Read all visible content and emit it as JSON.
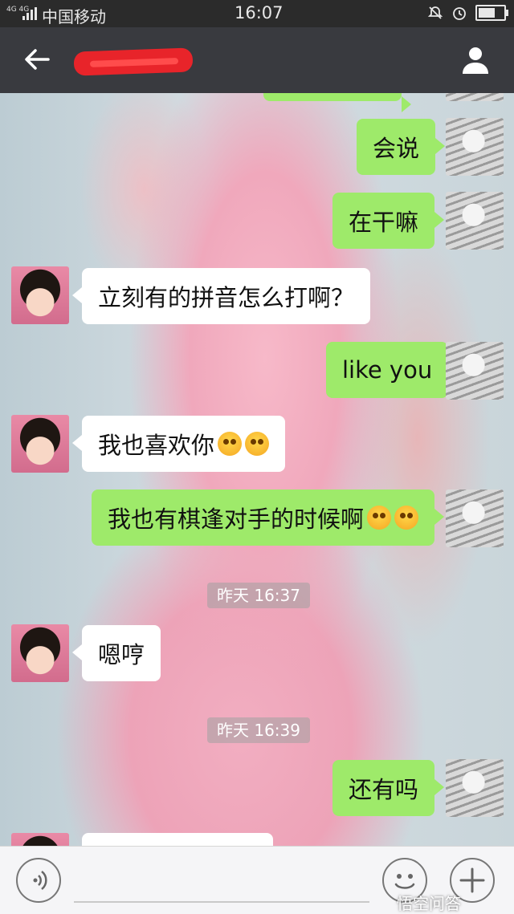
{
  "status_bar": {
    "network": "4G 4G",
    "carrier": "中国移动",
    "time": "16:07",
    "icons": [
      "bell-off-icon",
      "alarm-icon",
      "battery-icon"
    ]
  },
  "title_bar": {
    "back_icon": "arrow-left-icon",
    "title": "",
    "profile_icon": "person-icon"
  },
  "messages": [
    {
      "side": "out",
      "text": "会说"
    },
    {
      "side": "out",
      "text": "在干嘛"
    },
    {
      "side": "in",
      "text": "立刻有的拼音怎么打啊？"
    },
    {
      "side": "out",
      "text": "like you"
    },
    {
      "side": "in",
      "text": "我也喜欢你"
    },
    {
      "side": "out",
      "text": "我也有棋逢对手的时候啊"
    },
    {
      "side": "time",
      "text": "昨天 16:37"
    },
    {
      "side": "in",
      "text": "嗯哼"
    },
    {
      "side": "time",
      "text": "昨天 16:39"
    },
    {
      "side": "out",
      "text": "还有吗"
    }
  ],
  "bottom_bar": {
    "voice_icon": "voice-icon",
    "emoji_icon": "smiley-icon",
    "plus_icon": "plus-icon"
  },
  "watermark": "悟空问答",
  "colors": {
    "outgoing_bubble": "#9eea6a",
    "incoming_bubble": "#ffffff",
    "title_bar": "#393a3f"
  }
}
